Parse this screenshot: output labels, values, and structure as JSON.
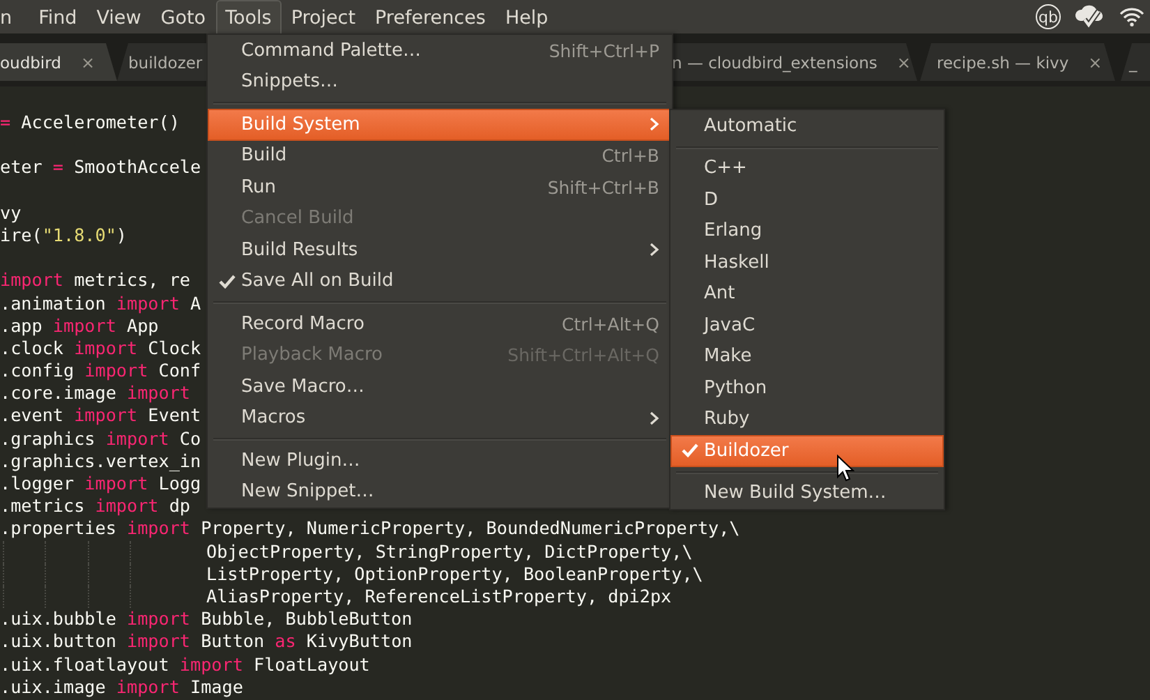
{
  "menubar": {
    "items": [
      {
        "label": "n",
        "selected": false
      },
      {
        "label": "Find",
        "selected": false
      },
      {
        "label": "View",
        "selected": false
      },
      {
        "label": "Goto",
        "selected": false
      },
      {
        "label": "Tools",
        "selected": true
      },
      {
        "label": "Project",
        "selected": false
      },
      {
        "label": "Preferences",
        "selected": false
      },
      {
        "label": "Help",
        "selected": false
      }
    ],
    "tray_badge": "qb"
  },
  "tabs": [
    {
      "label": "oudbird",
      "close": "×",
      "selected": true
    },
    {
      "label": "buildozer",
      "selected": false
    },
    {
      "label": "n — cloudbird_extensions",
      "close": "×",
      "selected": false
    },
    {
      "label": "recipe.sh — kivy",
      "close": "×",
      "selected": false
    },
    {
      "label": "_",
      "selected": false
    }
  ],
  "code_lines": [
    {
      "kind": "code",
      "segments": [
        {
          "text": "=",
          "kind": "kw"
        },
        {
          "text": " Accelerometer()",
          "kind": "plain"
        }
      ]
    },
    {
      "kind": "blank"
    },
    {
      "kind": "code",
      "segments": [
        {
          "text": "eter ",
          "kind": "plain"
        },
        {
          "text": "=",
          "kind": "kw"
        },
        {
          "text": " SmoothAccele",
          "kind": "plain"
        }
      ]
    },
    {
      "kind": "blank"
    },
    {
      "kind": "code",
      "segments": [
        {
          "text": "vy",
          "kind": "plain"
        }
      ]
    },
    {
      "kind": "code",
      "segments": [
        {
          "text": "ire(",
          "kind": "plain"
        },
        {
          "text": "\"1.8.0\"",
          "kind": "str"
        },
        {
          "text": ")",
          "kind": "plain"
        }
      ]
    },
    {
      "kind": "blank"
    },
    {
      "kind": "code",
      "segments": [
        {
          "text": "import",
          "kind": "kw"
        },
        {
          "text": " metrics, re",
          "kind": "plain"
        }
      ]
    },
    {
      "kind": "code",
      "segments": [
        {
          "text": ".animation ",
          "kind": "plain"
        },
        {
          "text": "import",
          "kind": "kw"
        },
        {
          "text": " A",
          "kind": "plain"
        }
      ]
    },
    {
      "kind": "code",
      "segments": [
        {
          "text": ".app ",
          "kind": "plain"
        },
        {
          "text": "import",
          "kind": "kw"
        },
        {
          "text": " App",
          "kind": "plain"
        }
      ]
    },
    {
      "kind": "code",
      "segments": [
        {
          "text": ".clock ",
          "kind": "plain"
        },
        {
          "text": "import",
          "kind": "kw"
        },
        {
          "text": " Clock",
          "kind": "plain"
        }
      ]
    },
    {
      "kind": "code",
      "segments": [
        {
          "text": ".config ",
          "kind": "plain"
        },
        {
          "text": "import",
          "kind": "kw"
        },
        {
          "text": " Conf",
          "kind": "plain"
        }
      ]
    },
    {
      "kind": "code",
      "segments": [
        {
          "text": ".core.image ",
          "kind": "plain"
        },
        {
          "text": "import",
          "kind": "kw"
        }
      ]
    },
    {
      "kind": "code",
      "segments": [
        {
          "text": ".event ",
          "kind": "plain"
        },
        {
          "text": "import",
          "kind": "kw"
        },
        {
          "text": " Event",
          "kind": "plain"
        }
      ]
    },
    {
      "kind": "code",
      "segments": [
        {
          "text": ".graphics ",
          "kind": "plain"
        },
        {
          "text": "import",
          "kind": "kw"
        },
        {
          "text": " Co",
          "kind": "plain"
        }
      ]
    },
    {
      "kind": "code",
      "segments": [
        {
          "text": ".graphics.vertex_in",
          "kind": "plain"
        }
      ]
    },
    {
      "kind": "code",
      "segments": [
        {
          "text": ".logger ",
          "kind": "plain"
        },
        {
          "text": "import",
          "kind": "kw"
        },
        {
          "text": " Logg",
          "kind": "plain"
        }
      ]
    },
    {
      "kind": "code",
      "segments": [
        {
          "text": ".metrics ",
          "kind": "plain"
        },
        {
          "text": "import",
          "kind": "kw"
        },
        {
          "text": " dp",
          "kind": "plain"
        }
      ]
    },
    {
      "kind": "code",
      "segments": [
        {
          "text": ".properties ",
          "kind": "plain"
        },
        {
          "text": "import",
          "kind": "kw"
        },
        {
          "text": " Property, NumericProperty, BoundedNumericProperty,\\",
          "kind": "plain"
        }
      ]
    },
    {
      "kind": "continuation",
      "segments": [
        {
          "text": "ObjectProperty, StringProperty, DictProperty,\\",
          "kind": "plain"
        }
      ]
    },
    {
      "kind": "continuation",
      "segments": [
        {
          "text": "ListProperty, OptionProperty, BooleanProperty,\\",
          "kind": "plain"
        }
      ]
    },
    {
      "kind": "continuation",
      "segments": [
        {
          "text": "AliasProperty, ReferenceListProperty, dpi2px",
          "kind": "plain"
        }
      ]
    },
    {
      "kind": "code",
      "segments": [
        {
          "text": ".uix.bubble ",
          "kind": "plain"
        },
        {
          "text": "import",
          "kind": "kw"
        },
        {
          "text": " Bubble, BubbleButton",
          "kind": "plain"
        }
      ]
    },
    {
      "kind": "code",
      "segments": [
        {
          "text": ".uix.button ",
          "kind": "plain"
        },
        {
          "text": "import",
          "kind": "kw"
        },
        {
          "text": " Button ",
          "kind": "plain"
        },
        {
          "text": "as",
          "kind": "kw"
        },
        {
          "text": " KivyButton",
          "kind": "plain"
        }
      ]
    },
    {
      "kind": "code",
      "segments": [
        {
          "text": ".uix.floatlayout ",
          "kind": "plain"
        },
        {
          "text": "import",
          "kind": "kw"
        },
        {
          "text": " FloatLayout",
          "kind": "plain"
        }
      ]
    },
    {
      "kind": "code",
      "segments": [
        {
          "text": ".uix.image ",
          "kind": "plain"
        },
        {
          "text": "import",
          "kind": "kw"
        },
        {
          "text": " Image",
          "kind": "plain"
        }
      ]
    }
  ],
  "tools_menu": [
    {
      "kind": "item",
      "label": "Command Palette…",
      "shortcut": "Shift+Ctrl+P",
      "disabled": false,
      "checked": false,
      "submenu": false,
      "selected": false
    },
    {
      "kind": "item",
      "label": "Snippets…",
      "disabled": false,
      "checked": false,
      "submenu": false,
      "selected": false
    },
    {
      "kind": "separator"
    },
    {
      "kind": "item",
      "label": "Build System",
      "disabled": false,
      "checked": false,
      "submenu": true,
      "selected": true
    },
    {
      "kind": "item",
      "label": "Build",
      "shortcut": "Ctrl+B",
      "disabled": false,
      "checked": false,
      "submenu": false,
      "selected": false
    },
    {
      "kind": "item",
      "label": "Run",
      "shortcut": "Shift+Ctrl+B",
      "disabled": false,
      "checked": false,
      "submenu": false,
      "selected": false
    },
    {
      "kind": "item",
      "label": "Cancel Build",
      "disabled": true,
      "checked": false,
      "submenu": false,
      "selected": false
    },
    {
      "kind": "item",
      "label": "Build Results",
      "disabled": false,
      "checked": false,
      "submenu": true,
      "selected": false
    },
    {
      "kind": "item",
      "label": "Save All on Build",
      "disabled": false,
      "checked": true,
      "submenu": false,
      "selected": false
    },
    {
      "kind": "separator"
    },
    {
      "kind": "item",
      "label": "Record Macro",
      "shortcut": "Ctrl+Alt+Q",
      "disabled": false,
      "checked": false,
      "submenu": false,
      "selected": false
    },
    {
      "kind": "item",
      "label": "Playback Macro",
      "shortcut": "Shift+Ctrl+Alt+Q",
      "disabled": true,
      "checked": false,
      "submenu": false,
      "selected": false
    },
    {
      "kind": "item",
      "label": "Save Macro…",
      "disabled": false,
      "checked": false,
      "submenu": false,
      "selected": false
    },
    {
      "kind": "item",
      "label": "Macros",
      "disabled": false,
      "checked": false,
      "submenu": true,
      "selected": false
    },
    {
      "kind": "separator"
    },
    {
      "kind": "item",
      "label": "New Plugin…",
      "disabled": false,
      "checked": false,
      "submenu": false,
      "selected": false
    },
    {
      "kind": "item",
      "label": "New Snippet…",
      "disabled": false,
      "checked": false,
      "submenu": false,
      "selected": false
    }
  ],
  "build_system_menu": [
    {
      "kind": "item",
      "label": "Automatic",
      "checked": false,
      "selected": false
    },
    {
      "kind": "separator"
    },
    {
      "kind": "item",
      "label": "C++",
      "checked": false,
      "selected": false
    },
    {
      "kind": "item",
      "label": "D",
      "checked": false,
      "selected": false
    },
    {
      "kind": "item",
      "label": "Erlang",
      "checked": false,
      "selected": false
    },
    {
      "kind": "item",
      "label": "Haskell",
      "checked": false,
      "selected": false
    },
    {
      "kind": "item",
      "label": "Ant",
      "checked": false,
      "selected": false
    },
    {
      "kind": "item",
      "label": "JavaC",
      "checked": false,
      "selected": false
    },
    {
      "kind": "item",
      "label": "Make",
      "checked": false,
      "selected": false
    },
    {
      "kind": "item",
      "label": "Python",
      "checked": false,
      "selected": false
    },
    {
      "kind": "item",
      "label": "Ruby",
      "checked": false,
      "selected": false
    },
    {
      "kind": "item",
      "label": "Buildozer",
      "checked": true,
      "selected": true
    },
    {
      "kind": "separator"
    },
    {
      "kind": "item",
      "label": "New Build System…",
      "checked": false,
      "selected": false
    }
  ]
}
